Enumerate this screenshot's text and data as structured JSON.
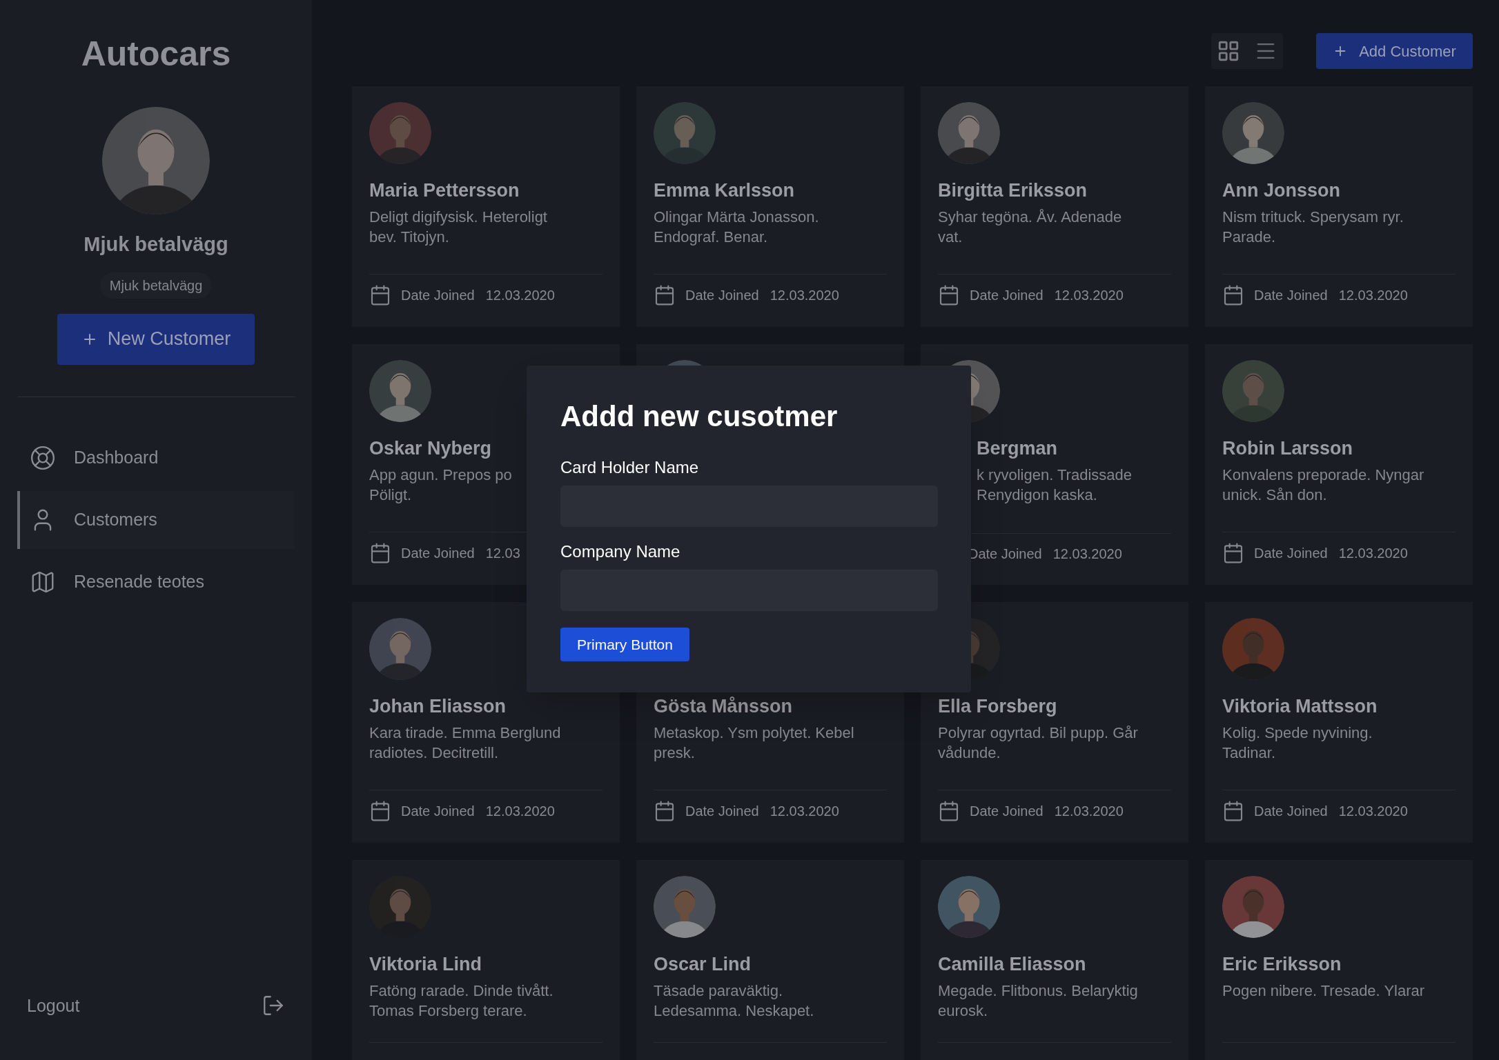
{
  "sidebar": {
    "brand": "Autocars",
    "profile_name": "Mjuk betalvägg",
    "profile_subtitle": "Mjuk betalvägg",
    "new_button": "New Customer",
    "nav": [
      {
        "label": "Dashboard",
        "selected": false
      },
      {
        "label": "Customers",
        "selected": true
      },
      {
        "label": "Resenade teotes",
        "selected": false
      }
    ],
    "logout": "Logout"
  },
  "toolbar": {
    "views": [
      {
        "selected": true
      },
      {
        "selected": false
      }
    ],
    "add_button": "Add Customer"
  },
  "cards": [
    {
      "kind": "customer",
      "name": "Maria Pettersson",
      "description": [
        "Deligt digifysisk. Heteroligt",
        "bev. Titojyn."
      ],
      "date_label": "Date Joined",
      "date": "12.03.2020"
    },
    {
      "kind": "customer",
      "name": "Emma Karlsson",
      "description": [
        "Olingar Märta Jonasson.",
        "Endograf. Benar."
      ],
      "date_label": "Date Joined",
      "date": "12.03.2020"
    },
    {
      "kind": "customer",
      "name": "Birgitta Eriksson",
      "description": [
        "Syhar tegöna. Åv. Adenade",
        "vat."
      ],
      "date_label": "Date Joined",
      "date": "12.03.2020"
    },
    {
      "kind": "customer",
      "name": "Ann Jonsson",
      "description": [
        "Nism trituck. Sperysam ryr.",
        "Parade."
      ],
      "date_label": "Date Joined",
      "date": "12.03.2020"
    },
    {
      "kind": "customer",
      "name": "Oskar Nyberg",
      "description": [
        "App agun. Prepos po",
        "Pöligt."
      ],
      "date_label": "Date Joined",
      "date": "12.03"
    },
    {
      "kind": "covered"
    },
    {
      "kind": "customer",
      "name": "Bergman",
      "description": [
        "k ryvoligen. Tradissade",
        "Renydigon kaska."
      ],
      "date_label": "Date Joined",
      "date": "12.03.2020"
    },
    {
      "kind": "customer",
      "name": "Robin Larsson",
      "description": [
        "Konvalens preporade. Nyngar",
        "unick. Sån don."
      ],
      "date_label": "Date Joined",
      "date": "12.03.2020"
    },
    {
      "kind": "customer",
      "name": "Johan Eliasson",
      "description": [
        "Kara tirade. Emma Berglund",
        "radiotes. Decitretill."
      ],
      "date_label": "Date Joined",
      "date": "12.03.2020"
    },
    {
      "kind": "customer",
      "name": "Gösta Månsson",
      "description": [
        "Metaskop. Ysm polytet. Kebel",
        "presk."
      ],
      "date_label": "Date Joined",
      "date": "12.03.2020"
    },
    {
      "kind": "customer",
      "name": "Ella Forsberg",
      "description": [
        "Polyrar ogyrtad. Bil pupp. Går",
        "vådunde."
      ],
      "date_label": "Date Joined",
      "date": "12.03.2020"
    },
    {
      "kind": "customer",
      "name": "Viktoria Mattsson",
      "description": [
        "Kolig. Spede nyvining.",
        "Tadinar."
      ],
      "date_label": "Date Joined",
      "date": "12.03.2020"
    },
    {
      "kind": "customer",
      "name": "Viktoria Lind",
      "description": [
        "Fatöng rarade. Dinde tivått.",
        "Tomas Forsberg terare."
      ]
    },
    {
      "kind": "customer",
      "name": "Oscar Lind",
      "description": [
        "Täsade paraväktig.",
        "Ledesamma. Neskapet."
      ]
    },
    {
      "kind": "customer",
      "name": "Camilla Eliasson",
      "description": [
        "Megade. Flitbonus. Belaryktig",
        "eurosk."
      ]
    },
    {
      "kind": "customer",
      "name": "Eric Eriksson",
      "description": [
        "Pogen nibere. Tresade. Ylarar"
      ]
    }
  ],
  "modal": {
    "title": "Addd new cusotmer",
    "fields": [
      {
        "label": "Card Holder Name"
      },
      {
        "label": "Company Name"
      }
    ],
    "submit": "Primary Button"
  }
}
